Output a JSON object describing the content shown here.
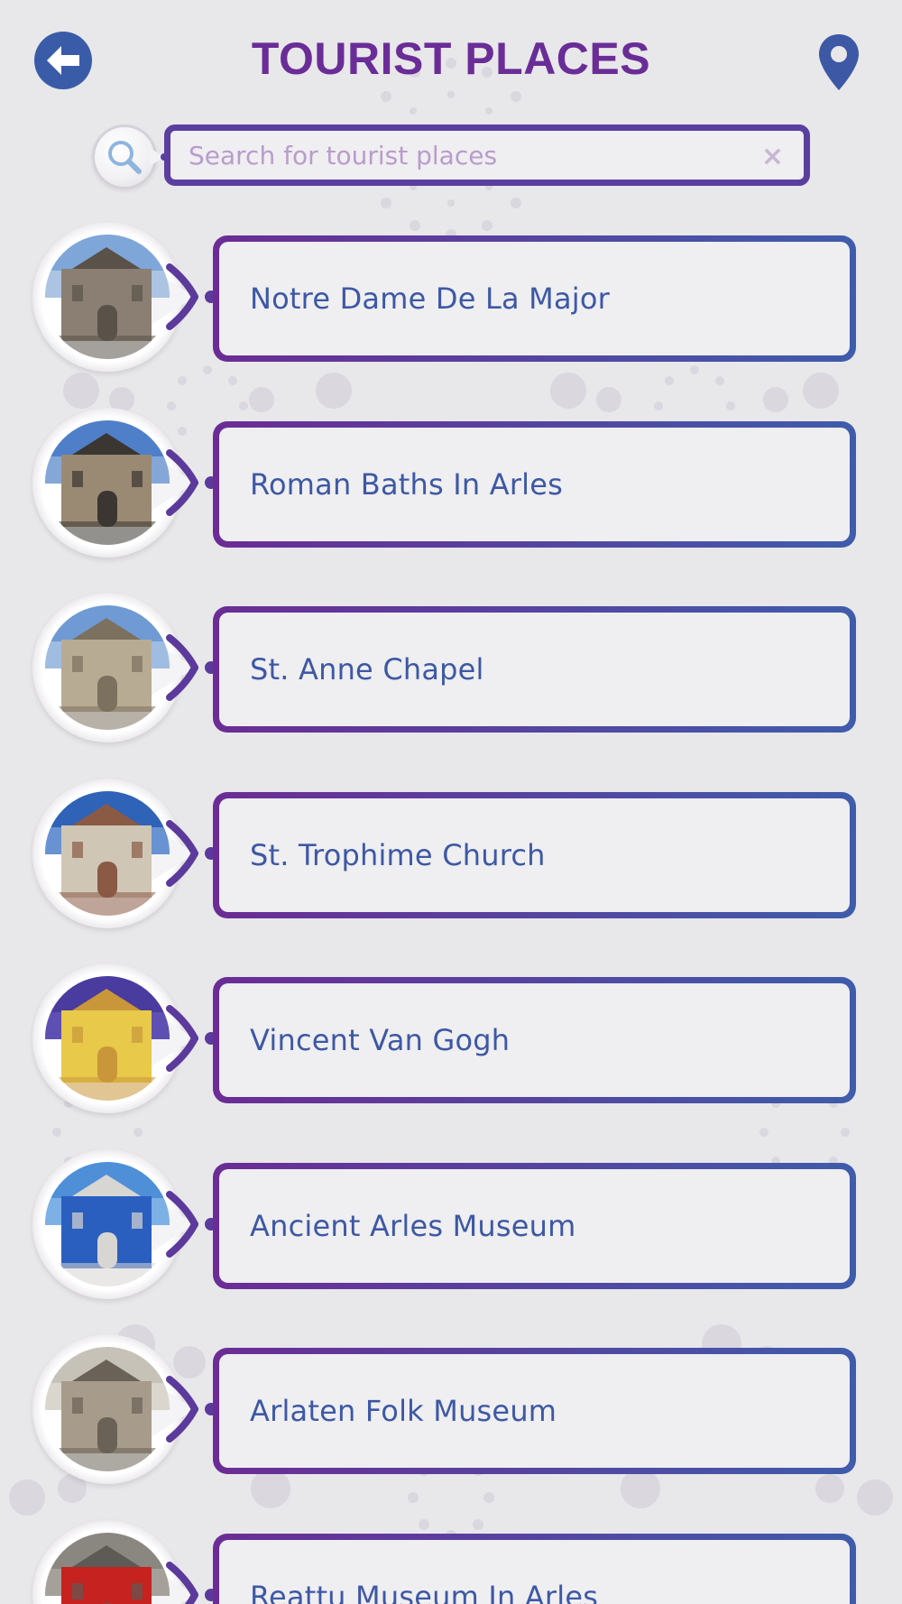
{
  "header": {
    "title": "TOURIST PLACES"
  },
  "search": {
    "placeholder": "Search for tourist places",
    "clear_label": "×"
  },
  "places": [
    {
      "label": "Notre Dame De La Major",
      "image": "church-stone-photo"
    },
    {
      "label": "Roman Baths In Arles",
      "image": "roman-ruins-photo"
    },
    {
      "label": "St. Anne Chapel",
      "image": "chapel-facade-photo"
    },
    {
      "label": "St. Trophime Church",
      "image": "church-portal-photo"
    },
    {
      "label": "Vincent Van Gogh",
      "image": "yellow-house-painting"
    },
    {
      "label": "Ancient Arles Museum",
      "image": "blue-museum-photo"
    },
    {
      "label": "Arlaten Folk Museum",
      "image": "stone-building-photo"
    },
    {
      "label": "Reattu Museum In Arles",
      "image": "red-door-photo"
    }
  ],
  "colors": {
    "title": "#6a2d97",
    "accent_blue": "#3d58a4",
    "accent_purple": "#6b2c95",
    "background": "#e8e7ea"
  }
}
